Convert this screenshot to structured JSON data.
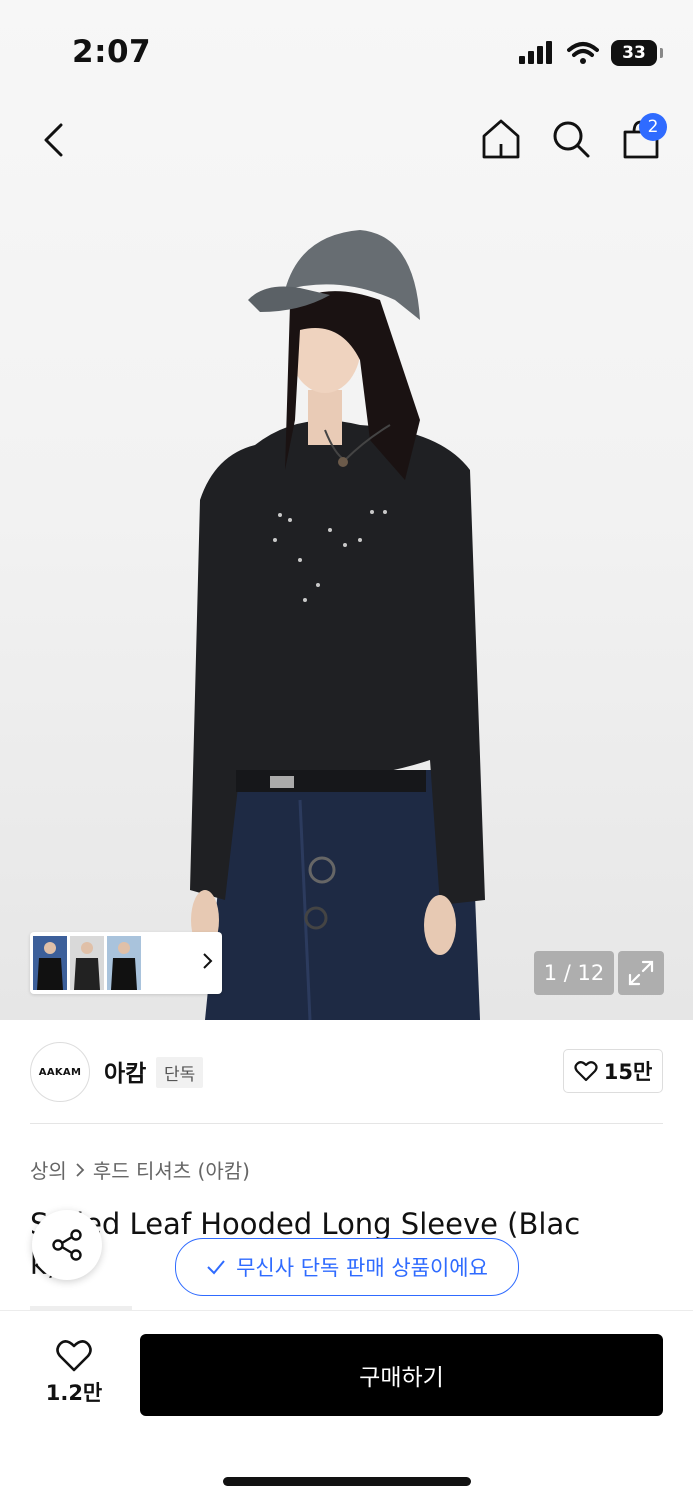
{
  "status_bar": {
    "time": "2:07",
    "battery": "33"
  },
  "nav": {
    "cart_count": "2"
  },
  "gallery": {
    "page_counter": "1 / 12"
  },
  "brand": {
    "logo_text": "AAKAM",
    "name": "아캄",
    "tag": "단독",
    "follow_count": "15만"
  },
  "breadcrumb": {
    "category": "상의",
    "subcategory": "후드 티셔츠 (아캄)"
  },
  "product": {
    "title_line1": "S  lded Leaf Hooded Long Sleeve (Blac",
    "title_line2": "k)"
  },
  "exclusive_notice": "무신사 단독 판매 상품이에요",
  "bottom_bar": {
    "like_count": "1.2만",
    "buy_label": "구매하기"
  },
  "colors": {
    "accent": "#2f6bff",
    "buy_button": "#000000"
  }
}
